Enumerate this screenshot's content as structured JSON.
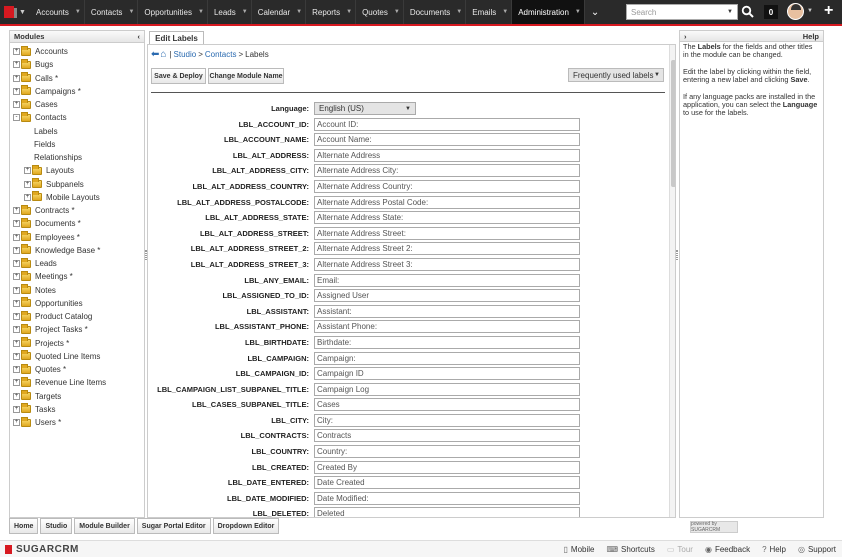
{
  "topnav": {
    "items": [
      {
        "label": "Accounts"
      },
      {
        "label": "Contacts"
      },
      {
        "label": "Opportunities"
      },
      {
        "label": "Leads"
      },
      {
        "label": "Calendar"
      },
      {
        "label": "Reports"
      },
      {
        "label": "Quotes"
      },
      {
        "label": "Documents"
      },
      {
        "label": "Emails"
      },
      {
        "label": "Administration",
        "active": true
      }
    ],
    "search_placeholder": "Search",
    "notification_count": "0"
  },
  "modules_panel": {
    "title": "Modules",
    "items": [
      {
        "label": "Accounts",
        "type": "folder",
        "expander": "+"
      },
      {
        "label": "Bugs",
        "type": "folder",
        "expander": "+"
      },
      {
        "label": "Calls *",
        "type": "folder",
        "expander": "+"
      },
      {
        "label": "Campaigns *",
        "type": "folder",
        "expander": "+"
      },
      {
        "label": "Cases",
        "type": "folder",
        "expander": "+"
      },
      {
        "label": "Contacts",
        "type": "folder",
        "expander": "-"
      },
      {
        "label": "Labels",
        "type": "leaf"
      },
      {
        "label": "Fields",
        "type": "leaf"
      },
      {
        "label": "Relationships",
        "type": "leaf"
      },
      {
        "label": "Layouts",
        "type": "subfolder",
        "expander": "+"
      },
      {
        "label": "Subpanels",
        "type": "subfolder",
        "expander": "+"
      },
      {
        "label": "Mobile Layouts",
        "type": "subfolder",
        "expander": "+"
      },
      {
        "label": "Contracts *",
        "type": "folder",
        "expander": "+"
      },
      {
        "label": "Documents *",
        "type": "folder",
        "expander": "+"
      },
      {
        "label": "Employees *",
        "type": "folder",
        "expander": "+"
      },
      {
        "label": "Knowledge Base *",
        "type": "folder",
        "expander": "+"
      },
      {
        "label": "Leads",
        "type": "folder",
        "expander": "+"
      },
      {
        "label": "Meetings *",
        "type": "folder",
        "expander": "+"
      },
      {
        "label": "Notes",
        "type": "folder",
        "expander": "+"
      },
      {
        "label": "Opportunities",
        "type": "folder",
        "expander": "+"
      },
      {
        "label": "Product Catalog",
        "type": "folder",
        "expander": "+"
      },
      {
        "label": "Project Tasks *",
        "type": "folder",
        "expander": "+"
      },
      {
        "label": "Projects *",
        "type": "folder",
        "expander": "+"
      },
      {
        "label": "Quoted Line Items",
        "type": "folder",
        "expander": "+"
      },
      {
        "label": "Quotes *",
        "type": "folder",
        "expander": "+"
      },
      {
        "label": "Revenue Line Items",
        "type": "folder",
        "expander": "+"
      },
      {
        "label": "Targets",
        "type": "folder",
        "expander": "+"
      },
      {
        "label": "Tasks",
        "type": "folder",
        "expander": "+"
      },
      {
        "label": "Users *",
        "type": "folder",
        "expander": "+"
      }
    ]
  },
  "main": {
    "tab_label": "Edit Labels",
    "breadcrumb": {
      "sep1": "|",
      "studio": "Studio",
      "gt1": ">",
      "contacts": "Contacts",
      "gt2": ">",
      "current": "Labels"
    },
    "buttons": {
      "save_deploy": "Save & Deploy",
      "change_module_name": "Change Module Name"
    },
    "frequently_used": "Frequently used labels",
    "language_label": "Language:",
    "language_value": "English (US)",
    "labels": [
      {
        "key": "LBL_ACCOUNT_ID:",
        "value": "Account ID:"
      },
      {
        "key": "LBL_ACCOUNT_NAME:",
        "value": "Account Name:"
      },
      {
        "key": "LBL_ALT_ADDRESS:",
        "value": "Alternate Address"
      },
      {
        "key": "LBL_ALT_ADDRESS_CITY:",
        "value": "Alternate Address City:"
      },
      {
        "key": "LBL_ALT_ADDRESS_COUNTRY:",
        "value": "Alternate Address Country:"
      },
      {
        "key": "LBL_ALT_ADDRESS_POSTALCODE:",
        "value": "Alternate Address Postal Code:"
      },
      {
        "key": "LBL_ALT_ADDRESS_STATE:",
        "value": "Alternate Address State:"
      },
      {
        "key": "LBL_ALT_ADDRESS_STREET:",
        "value": "Alternate Address Street:"
      },
      {
        "key": "LBL_ALT_ADDRESS_STREET_2:",
        "value": "Alternate Address Street 2:"
      },
      {
        "key": "LBL_ALT_ADDRESS_STREET_3:",
        "value": "Alternate Address Street 3:"
      },
      {
        "key": "LBL_ANY_EMAIL:",
        "value": "Email:"
      },
      {
        "key": "LBL_ASSIGNED_TO_ID:",
        "value": "Assigned User"
      },
      {
        "key": "LBL_ASSISTANT:",
        "value": "Assistant:"
      },
      {
        "key": "LBL_ASSISTANT_PHONE:",
        "value": "Assistant Phone:"
      },
      {
        "key": "LBL_BIRTHDATE:",
        "value": "Birthdate:"
      },
      {
        "key": "LBL_CAMPAIGN:",
        "value": "Campaign:"
      },
      {
        "key": "LBL_CAMPAIGN_ID:",
        "value": "Campaign ID"
      },
      {
        "key": "LBL_CAMPAIGN_LIST_SUBPANEL_TITLE:",
        "value": "Campaign Log"
      },
      {
        "key": "LBL_CASES_SUBPANEL_TITLE:",
        "value": "Cases"
      },
      {
        "key": "LBL_CITY:",
        "value": "City:"
      },
      {
        "key": "LBL_CONTRACTS:",
        "value": "Contracts"
      },
      {
        "key": "LBL_COUNTRY:",
        "value": "Country:"
      },
      {
        "key": "LBL_CREATED:",
        "value": "Created By"
      },
      {
        "key": "LBL_DATE_ENTERED:",
        "value": "Date Created"
      },
      {
        "key": "LBL_DATE_MODIFIED:",
        "value": "Date Modified:"
      },
      {
        "key": "LBL_DELETED:",
        "value": "Deleted"
      }
    ]
  },
  "help_panel": {
    "title": "Help",
    "p1_a": "The ",
    "p1_b": "Labels",
    "p1_c": " for the fields and other titles in the module can be changed.",
    "p2_a": "Edit the label by clicking within the field, entering a new label and clicking ",
    "p2_b": "Save",
    "p2_c": ".",
    "p3_a": "If any language packs are installed in the application, you can select the ",
    "p3_b": "Language",
    "p3_c": " to use for the labels."
  },
  "bottom_tabs": [
    "Home",
    "Studio",
    "Module Builder",
    "Sugar Portal Editor",
    "Dropdown Editor"
  ],
  "powered_by": "powered by SUGARCRM",
  "footer": {
    "logo": "SUGARCRM",
    "links": [
      {
        "label": "Mobile",
        "icon": "mobile-icon"
      },
      {
        "label": "Shortcuts",
        "icon": "keyboard-icon"
      },
      {
        "label": "Tour",
        "icon": "tour-icon",
        "disabled": true
      },
      {
        "label": "Feedback",
        "icon": "feedback-icon"
      },
      {
        "label": "Help",
        "icon": "help-icon"
      },
      {
        "label": "Support",
        "icon": "support-icon"
      }
    ]
  },
  "colors": {
    "topbar": "#2a2a2a",
    "accent": "#d71920",
    "link": "#2a6ab0"
  }
}
